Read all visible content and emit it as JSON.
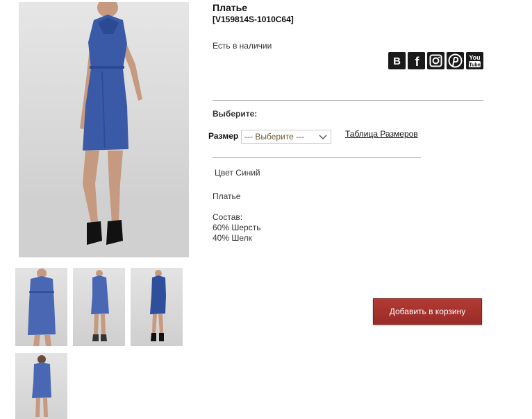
{
  "product": {
    "title": "Платье",
    "sku": "[V159814S-1010C64]",
    "stock_status": "Есть в наличии",
    "choose_label": "Выберите:",
    "size_label": "Размер",
    "size_select_value": "--- Выберите ---",
    "size_table_link": "Таблица Размеров",
    "color_text": "Цвет Синий",
    "description": "Платье",
    "composition_title": "Состав:",
    "composition": [
      "60% Шерсть",
      "40% Шелк"
    ],
    "add_to_cart_label": "Добавить в корзину"
  },
  "social": [
    {
      "icon": "vk-icon",
      "glyph": "В"
    },
    {
      "icon": "facebook-icon",
      "glyph": "f"
    },
    {
      "icon": "instagram-icon"
    },
    {
      "icon": "pinterest-icon"
    },
    {
      "icon": "youtube-icon",
      "glyph_top": "You",
      "glyph_bottom": "Tube"
    }
  ],
  "colors": {
    "dress": "#3a5aa8",
    "button": "#a8332e",
    "social_bg": "#1a1a1a"
  }
}
